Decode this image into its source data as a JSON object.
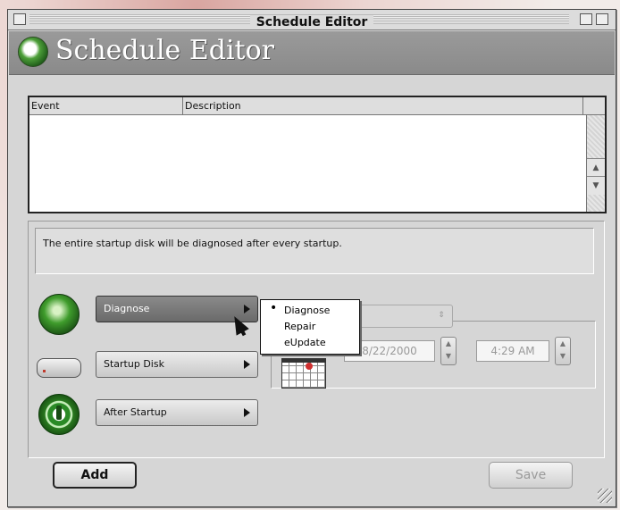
{
  "window": {
    "title": "Schedule Editor"
  },
  "header": {
    "title": "Schedule Editor"
  },
  "table": {
    "columns": [
      "Event",
      "Description"
    ],
    "rows": []
  },
  "status_text": "The entire startup disk will be diagnosed after every startup.",
  "action_popup": {
    "value": "Diagnose"
  },
  "target_popup": {
    "value": "Startup Disk"
  },
  "when_popup": {
    "value": "After Startup"
  },
  "action_menu": {
    "items": [
      "Diagnose",
      "Repair",
      "eUpdate"
    ],
    "selected": "Diagnose",
    "check_mark": "•"
  },
  "date_field": {
    "value": "8/22/2000"
  },
  "time_field": {
    "value": "4:29 AM"
  },
  "buttons": {
    "add": "Add",
    "save": "Save"
  },
  "colors": {
    "header_bg": "#8f8f8f",
    "window_bg": "#d6d6d6",
    "accent_green": "#3f9c2c"
  }
}
